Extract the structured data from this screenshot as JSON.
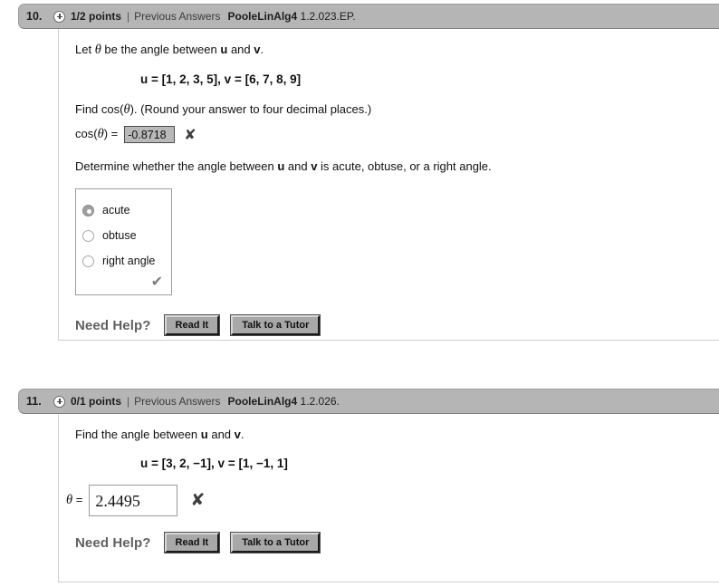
{
  "problems": [
    {
      "number": "10.",
      "plus_icon": "plus-circle-icon",
      "points": "1/2 points",
      "separator": "|",
      "previous_answers": "Previous Answers",
      "book_ref_bold": "PooleLinAlg4",
      "book_ref_rest": " 1.2.023.EP.",
      "intro_pre": "Let ",
      "intro_theta": "θ",
      "intro_post_a": " be the angle between ",
      "intro_u": "u",
      "intro_and": " and ",
      "intro_v": "v",
      "intro_end": ".",
      "equation": "u = [1, 2, 3, 5], v = [6, 7, 8, 9]",
      "equation_u": "u",
      "equation_u_vals": " = [1, 2, 3, 5], ",
      "equation_v": "v",
      "equation_v_vals": " = [6, 7, 8, 9]",
      "prompt_pre": "Find cos(",
      "prompt_theta": "θ",
      "prompt_post": "). (Round your answer to four decimal places.)",
      "answer_label_pre": "cos(",
      "answer_label_theta": "θ",
      "answer_label_post": ") = ",
      "answer_value": "-0.8718",
      "answer_mark": "✘",
      "determine_pre": "Determine whether the angle between ",
      "determine_u": "u",
      "determine_mid": " and ",
      "determine_v": "v",
      "determine_post": " is acute, obtuse, or a right angle.",
      "radio_options": [
        {
          "label": "acute",
          "selected": true
        },
        {
          "label": "obtuse",
          "selected": false
        },
        {
          "label": "right angle",
          "selected": false
        }
      ],
      "radio_mark": "✔",
      "need_help_label": "Need Help?",
      "read_it_label": "Read It",
      "tutor_label": "Talk to a Tutor"
    },
    {
      "number": "11.",
      "plus_icon": "plus-circle-icon",
      "points": "0/1 points",
      "separator": "|",
      "previous_answers": "Previous Answers",
      "book_ref_bold": "PooleLinAlg4",
      "book_ref_rest": " 1.2.026.",
      "intro_pre": "Find the angle between ",
      "intro_u": "u",
      "intro_and": " and ",
      "intro_v": "v",
      "intro_end": ".",
      "equation_u": "u",
      "equation_u_vals": " = [3, 2, −1], ",
      "equation_v": "v",
      "equation_v_vals": " = [1, −1, 1]",
      "answer_label_theta": "θ",
      "answer_label_eq": " = ",
      "answer_value": "2.4495",
      "answer_mark": "✘",
      "need_help_label": "Need Help?",
      "read_it_label": "Read It",
      "tutor_label": "Talk to a Tutor"
    }
  ],
  "colors": {
    "header_bar": "#b5b5b5",
    "graded_field": "#b9b9b9",
    "button_face": "#a8a8a8",
    "need_help_text": "#606060",
    "mark_wrong": "#3e3e3e",
    "mark_right": "#7d7d7d"
  }
}
